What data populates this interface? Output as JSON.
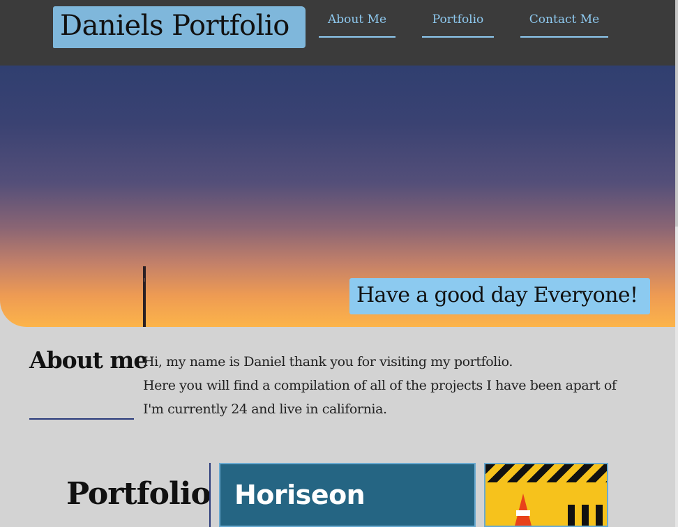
{
  "header": {
    "brand": "Daniels Portfolio",
    "nav": [
      {
        "label": "About Me"
      },
      {
        "label": "Portfolio"
      },
      {
        "label": "Contact Me"
      }
    ]
  },
  "hero": {
    "caption": "Have a good day Everyone!"
  },
  "about": {
    "title": "About me",
    "lines": [
      "Hi, my name is Daniel thank you for visiting my portfolio.",
      "Here you will find a compilation of all of the projects I have been apart of",
      "I'm currently 24 and live in california."
    ]
  },
  "portfolio": {
    "title": "Portfolio",
    "cards": [
      {
        "image_text": "Horiseon"
      },
      {
        "image_text": ""
      }
    ]
  },
  "colors": {
    "header_bg": "#3b3b3b",
    "accent": "#8ccaf0",
    "page_bg": "#d3d3d3",
    "rule": "#2a3a7a"
  }
}
